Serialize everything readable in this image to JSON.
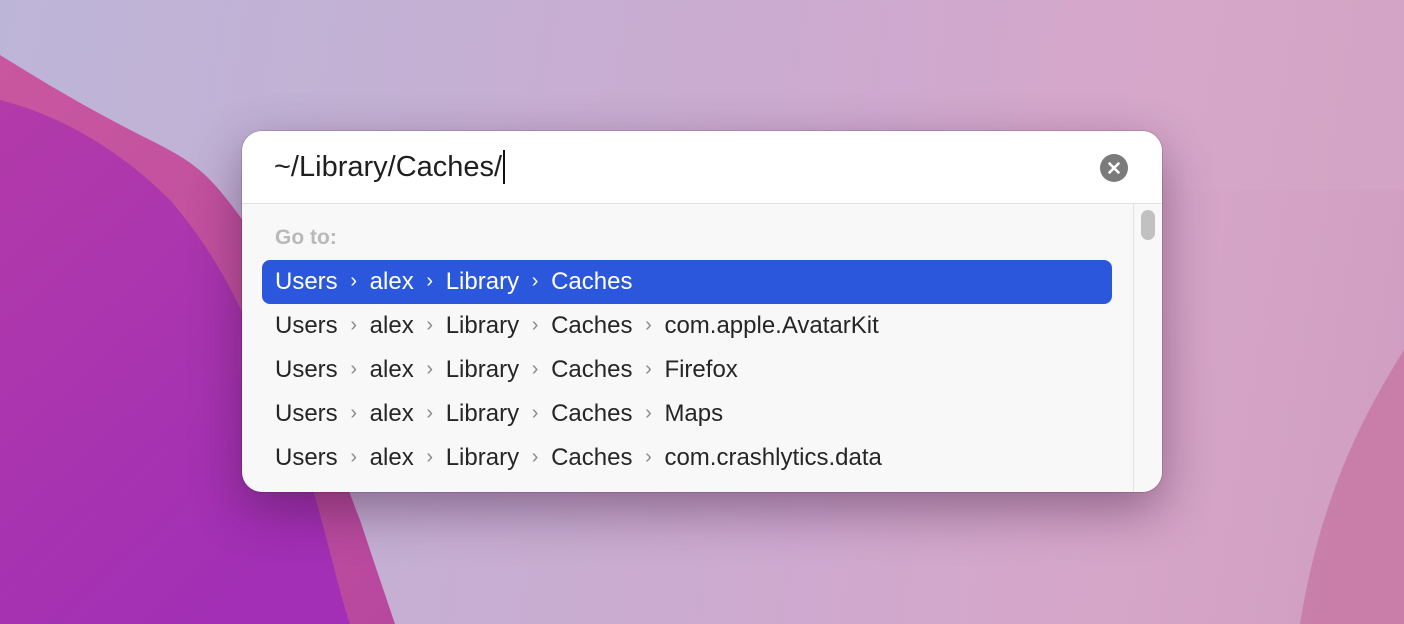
{
  "search": {
    "value": "~/Library/Caches/",
    "clear_label": "Clear"
  },
  "results": {
    "section_label": "Go to:",
    "separator_glyph": "›",
    "items": [
      {
        "segments": [
          "Users",
          "alex",
          "Library",
          "Caches"
        ],
        "selected": true
      },
      {
        "segments": [
          "Users",
          "alex",
          "Library",
          "Caches",
          "com.apple.AvatarKit"
        ],
        "selected": false
      },
      {
        "segments": [
          "Users",
          "alex",
          "Library",
          "Caches",
          "Firefox"
        ],
        "selected": false
      },
      {
        "segments": [
          "Users",
          "alex",
          "Library",
          "Caches",
          "Maps"
        ],
        "selected": false
      },
      {
        "segments": [
          "Users",
          "alex",
          "Library",
          "Caches",
          "com.crashlytics.data"
        ],
        "selected": false
      }
    ]
  },
  "colors": {
    "selection": "#2b57dc",
    "section_label": "#b9b9b9",
    "clear_button": "#7b7b7b",
    "scroll_thumb": "#c1c1c1"
  }
}
